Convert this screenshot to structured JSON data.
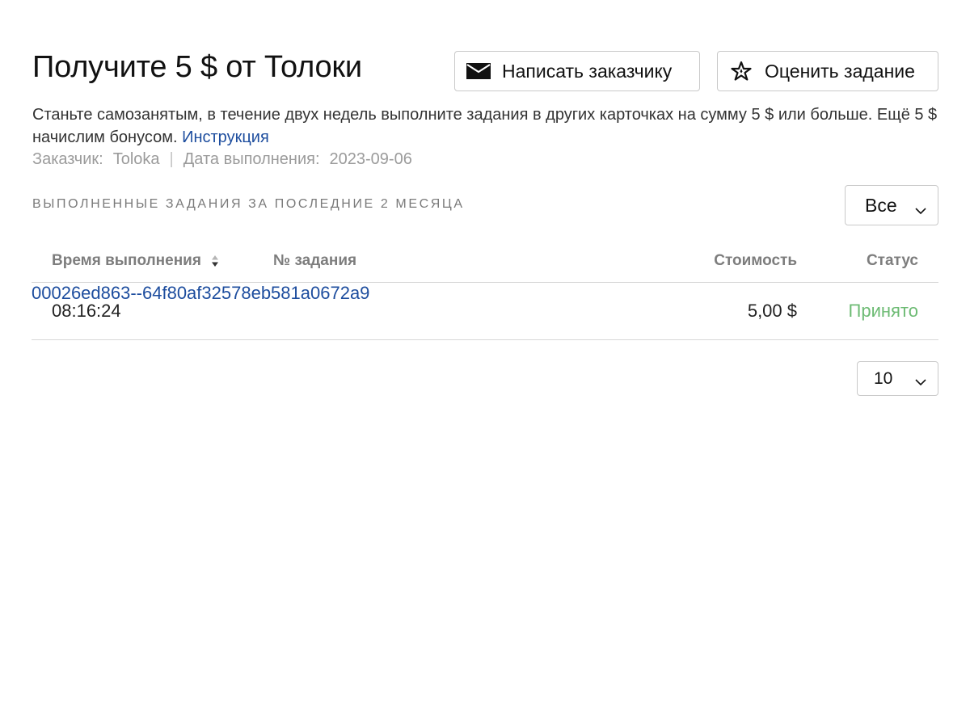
{
  "header": {
    "title": "Получите 5 $ от Толоки",
    "write_button_label": "Написать заказчику",
    "rate_button_label": "Оценить задание"
  },
  "description": {
    "text": "Станьте самозанятым, в течение двух недель выполните задания в других карточках на сумму 5 $ или больше. Ещё 5 $ начислим бонусом.",
    "link_label": "Инструкция"
  },
  "meta": {
    "requester_label": "Заказчик:",
    "requester_value": "Toloka",
    "separator": "|",
    "date_label": "Дата выполнения:",
    "date_value": "2023-09-06"
  },
  "tasks": {
    "section_title": "Выполненные задания за последние 2 месяца",
    "filter_value": "Все",
    "columns": {
      "time": "Время выполнения",
      "number": "№ задания",
      "cost": "Стоимость",
      "status": "Статус"
    },
    "rows": [
      {
        "time": "08:16:24",
        "number": "00026ed863--64f80af32578eb581a0672a9",
        "cost": "5,00 $",
        "status": "Принято"
      }
    ],
    "page_size": "10"
  },
  "colors": {
    "link": "#1d4d9e",
    "status_accepted": "#6dbb74",
    "muted": "#9b9b9b"
  },
  "icons": {
    "write": "envelope-icon",
    "rate": "star-icon",
    "sort": "sort-icon",
    "dropdown": "chevron-down-icon"
  }
}
